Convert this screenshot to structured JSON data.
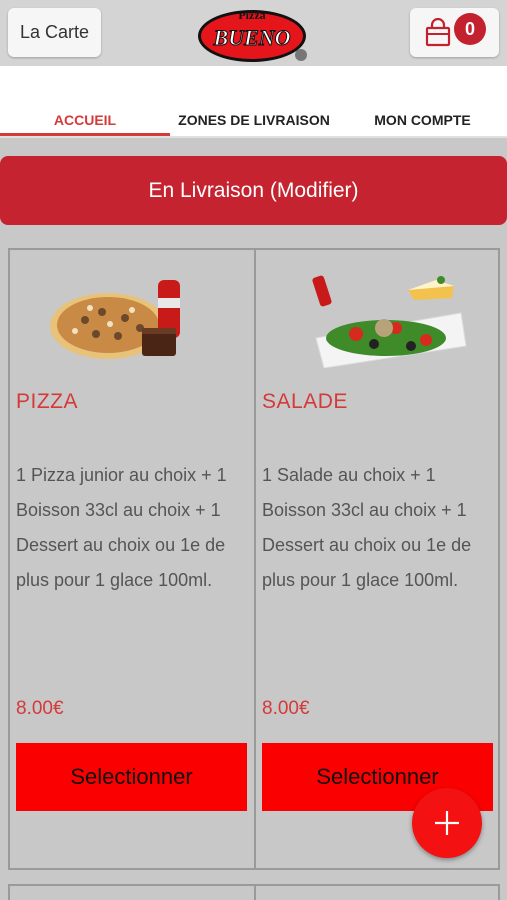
{
  "header": {
    "menu_label": "La Carte",
    "logo_top": "Pizza",
    "logo_main": "BUENO",
    "cart_count": "0"
  },
  "tabs": [
    {
      "label": "ACCUEIL",
      "active": true
    },
    {
      "label": "ZONES DE LIVRAISON",
      "active": false
    },
    {
      "label": "MON COMPTE",
      "active": false
    }
  ],
  "delivery_label": "En Livraison (Modifier)",
  "products": [
    {
      "title": "PIZZA",
      "description": "1 Pizza junior au choix  + 1 Boisson 33cl au choix  + 1 Dessert au choix ou 1e de plus pour 1 glace 100ml.",
      "price": "8.00€",
      "button": "Selectionner",
      "image": "pizza-menu-image"
    },
    {
      "title": "SALADE",
      "description": "1 Salade au choix  + 1 Boisson 33cl au choix  + 1 Dessert au choix ou 1e de plus pour 1 glace 100ml.",
      "price": "8.00€",
      "button": "Selectionner",
      "image": "salad-menu-image"
    }
  ],
  "colors": {
    "brand_red": "#c4232f",
    "button_red": "#fb0000",
    "accent_text": "#d43a3a",
    "fab": "#f41111"
  },
  "icons": {
    "cart": "shopping-bag-icon",
    "fab": "plus-icon"
  }
}
